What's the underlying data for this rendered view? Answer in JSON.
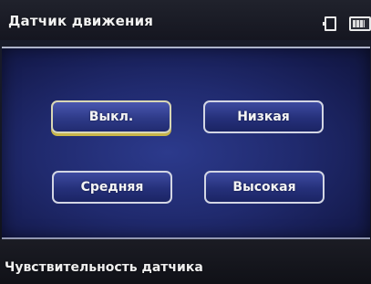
{
  "header": {
    "title": "Датчик движения",
    "icons": [
      "memory-card-icon",
      "battery-icon"
    ],
    "battery_level_percent": 80
  },
  "sensitivity_options": {
    "selected": "Выкл.",
    "items": [
      {
        "label": "Выкл."
      },
      {
        "label": "Низкая"
      },
      {
        "label": "Средняя"
      },
      {
        "label": "Высокая"
      }
    ]
  },
  "footer": {
    "caption": "Чувствительность датчика"
  },
  "colors": {
    "panel_blue": "#202a6e",
    "button_border": "#d3d6e4",
    "selection_underline": "#c9b64a",
    "text": "#f4f4f4"
  }
}
